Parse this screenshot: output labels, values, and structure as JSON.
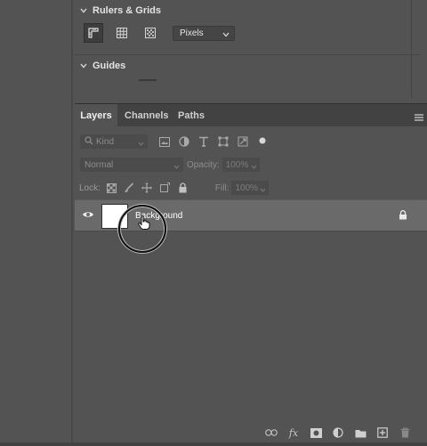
{
  "rulers_grids": {
    "title": "Rulers & Grids",
    "icons": [
      "ruler-icon",
      "grid-icon",
      "pixel-grid-icon"
    ],
    "units": {
      "selected": "Pixels"
    }
  },
  "guides": {
    "title": "Guides"
  },
  "layers_panel": {
    "tabs": [
      {
        "label": "Layers",
        "active": true
      },
      {
        "label": "Channels",
        "active": false
      },
      {
        "label": "Paths",
        "active": false
      }
    ],
    "filter": {
      "kind_label": "Kind",
      "icons": [
        "image-filter-icon",
        "adjustment-filter-icon",
        "type-filter-icon",
        "shape-filter-icon",
        "smart-object-filter-icon",
        "filter-toggle-icon"
      ]
    },
    "blend_mode": "Normal",
    "opacity_label": "Opacity:",
    "opacity_value": "100%",
    "lock_label": "Lock:",
    "lock_icons": [
      "lock-transparent-icon",
      "lock-image-icon",
      "lock-position-icon",
      "lock-artboard-icon",
      "lock-all-icon"
    ],
    "fill_label": "Fill:",
    "fill_value": "100%",
    "layers": [
      {
        "name": "Background",
        "visible": true,
        "locked": true,
        "selected": true
      }
    ],
    "footer_icons": [
      "link-layers-icon",
      "fx-icon",
      "add-mask-icon",
      "adjustment-layer-icon",
      "new-group-icon",
      "new-layer-icon",
      "delete-layer-icon"
    ],
    "fx_label": "fx"
  },
  "colors": {
    "panel_bg": "#535353",
    "tab_bar_bg": "#424242",
    "selected_layer_bg": "#6a6a6a"
  }
}
